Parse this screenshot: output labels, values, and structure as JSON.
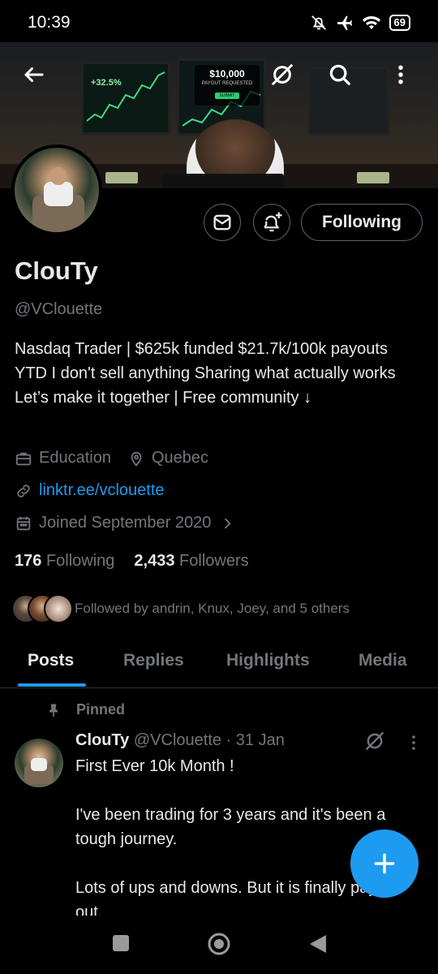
{
  "status_bar": {
    "time": "10:39",
    "battery": "69"
  },
  "banner": {
    "gain": "+32.5%",
    "payout_amount": "$10,000",
    "payout_label": "PAYOUT REQUESTED",
    "submit_label": "SUBMIT"
  },
  "actions": {
    "following_label": "Following"
  },
  "profile": {
    "name": "ClouTy",
    "handle": "@VClouette",
    "bio": "Nasdaq Trader | $625k funded $21.7k/100k payouts YTD I don't sell anything Sharing what actually works Let’s make it together | Free community ↓",
    "category": "Education",
    "location": "Quebec",
    "link": "linktr.ee/vclouette",
    "joined": "Joined September 2020",
    "following_count": "176",
    "following_label": "Following",
    "followers_count": "2,433",
    "followers_label": "Followers",
    "followed_by": "Followed by andrin, Knux, Joey, and 5 others"
  },
  "tabs": [
    {
      "label": "Posts"
    },
    {
      "label": "Replies"
    },
    {
      "label": "Highlights"
    },
    {
      "label": "Media"
    }
  ],
  "pinned_post": {
    "pinned_label": "Pinned",
    "name": "ClouTy",
    "meta": "@VClouette · 31 Jan",
    "text": "First Ever 10k Month !\n\nI've been trading for 3 years and it's been a tough journey.\n\nLots of ups and downs. But it is finally paying out."
  },
  "colors": {
    "accent": "#1d9bf0",
    "background": "#000000",
    "muted": "#71767b"
  }
}
